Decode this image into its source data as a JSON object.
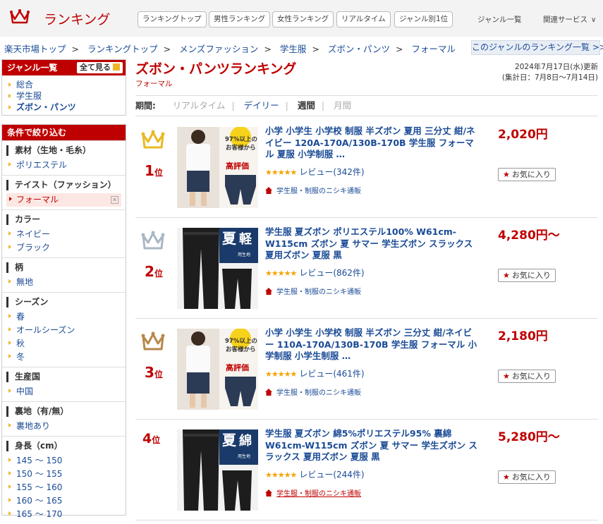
{
  "header": {
    "title": "ランキング",
    "nav": [
      "ランキングトップ",
      "男性ランキング",
      "女性ランキング",
      "リアルタイム",
      "ジャンル別1位"
    ],
    "genre_list": "ジャンル一覧",
    "related": "関連サービス"
  },
  "breadcrumb": [
    "楽天市場トップ",
    "ランキングトップ",
    "メンズファッション",
    "学生服",
    "ズボン・パンツ",
    "フォーマル"
  ],
  "genre_ranking_link": "このジャンルのランキング一覧 >>",
  "sidebar": {
    "genre_title": "ジャンル一覧",
    "show_all": "全て見る",
    "genres": [
      "総合",
      "学生服",
      "ズボン・パンツ"
    ],
    "filter_title": "条件で絞り込む",
    "filters": [
      {
        "head": "素材（生地・毛糸）",
        "items": [
          "ポリエステル"
        ]
      },
      {
        "head": "テイスト（ファッション）",
        "items": [
          "フォーマル"
        ],
        "selected": "フォーマル"
      },
      {
        "head": "カラー",
        "items": [
          "ネイビー",
          "ブラック"
        ]
      },
      {
        "head": "柄",
        "items": [
          "無地"
        ]
      },
      {
        "head": "シーズン",
        "items": [
          "春",
          "オールシーズン",
          "秋",
          "冬"
        ]
      },
      {
        "head": "生産国",
        "items": [
          "中国"
        ]
      },
      {
        "head": "裏地（有/無）",
        "items": [
          "裏地あり"
        ]
      },
      {
        "head": "身長（cm）",
        "items": [
          "145 〜 150",
          "150 〜 155",
          "155 〜 160",
          "160 〜 165",
          "165 〜 170"
        ]
      }
    ]
  },
  "main": {
    "title": "ズボン・パンツランキング",
    "subtitle": "フォーマル",
    "updated": "2024年7月17日(水)更新",
    "range": "(集計日：7月8日〜7月14日)",
    "period_label": "期間:",
    "periods": [
      "リアルタイム",
      "デイリー",
      "週間",
      "月間"
    ],
    "fav_label": "お気に入り",
    "rank_suffix": "位",
    "items": [
      {
        "rank": "1",
        "name": "小学 小学生 小学校 制服 半ズボン 夏用 三分丈 紺/ネイビー 120A-170A/130B-170B 学生服 フォーマル 夏服 小学制服 …",
        "review": "レビュー(342件)",
        "shop": "学生服・制服のニシキ通販",
        "price": "2,020円",
        "crown": "#e8b923"
      },
      {
        "rank": "2",
        "name": "学生服 夏ズボン ポリエステル100% W61cm-W115cm ズボン 夏 サマー 学生ズボン スラックス 夏用ズボン 夏服 黒",
        "review": "レビュー(862件)",
        "shop": "学生服・制服のニシキ通販",
        "price": "4,280円〜",
        "crown": "#aab7c4"
      },
      {
        "rank": "3",
        "name": "小学 小学生 小学校 制服 半ズボン 三分丈 紺/ネイビー 110A-170A/130B-170B 学生服 フォーマル 小学制服 小学生制服 …",
        "review": "レビュー(461件)",
        "shop": "学生服・制服のニシキ通販",
        "price": "2,180円",
        "crown": "#b8874a"
      },
      {
        "rank": "4",
        "name": "学生服 夏ズボン 綿5%ポリエステル95% 裏綿 W61cm-W115cm ズボン 夏 サマー 学生ズボン スラックス 夏用ズボン 夏服 黒",
        "review": "レビュー(244件)",
        "shop": "学生服・制服のニシキ通販",
        "price": "5,280円〜"
      }
    ],
    "thumb_text": {
      "pct": "97%以上の",
      "guests": "お客様から",
      "high": "高評価",
      "summer": "夏",
      "light": "軽",
      "cotton": "綿",
      "useface": "用生地"
    }
  },
  "colors": {
    "brand": "#bf0000",
    "link": "#1a4b96",
    "star": "#f5a300"
  }
}
